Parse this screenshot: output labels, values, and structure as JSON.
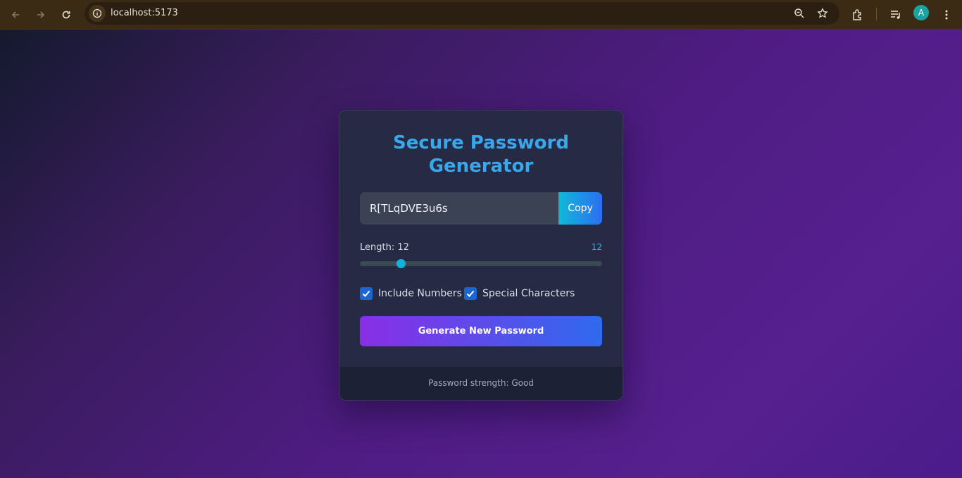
{
  "browser": {
    "url": "localhost:5173",
    "profile_initial": "A",
    "icons": [
      "back-icon",
      "forward-icon",
      "reload-icon",
      "site-info-icon",
      "zoom-icon",
      "bookmark-star-icon",
      "extensions-icon",
      "media-controls-icon",
      "menu-icon"
    ]
  },
  "card": {
    "title": "Secure Password Generator",
    "password": "R[TLqDVE3u6s",
    "copy_label": "Copy",
    "length_label": "Length: 12",
    "length_value": "12",
    "length_fraction": 0.17,
    "options": [
      {
        "label": "Include Numbers",
        "checked": true
      },
      {
        "label": "Special Characters",
        "checked": true
      }
    ],
    "generate_label": "Generate New Password",
    "strength_text": "Password strength: Good"
  },
  "colors": {
    "title": "#38a8ea",
    "accent": "#11b4d8",
    "button_start": "#8a2ee6",
    "button_end": "#2f6aee",
    "checkbox": "#1a66d4"
  }
}
